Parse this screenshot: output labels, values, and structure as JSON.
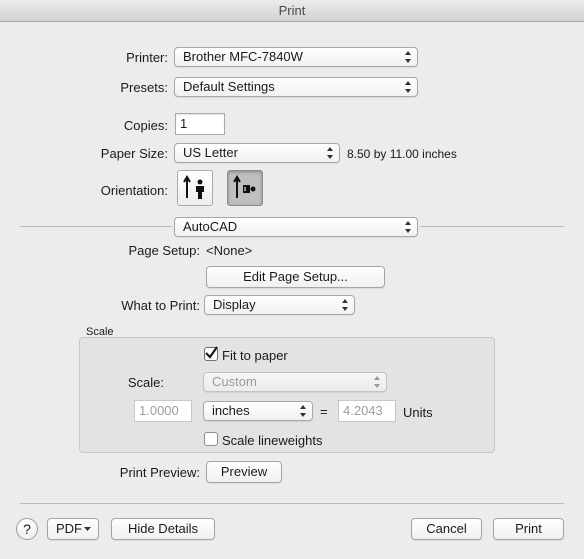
{
  "window": {
    "title": "Print"
  },
  "printer": {
    "label": "Printer:",
    "value": "Brother MFC-7840W"
  },
  "presets": {
    "label": "Presets:",
    "value": "Default Settings"
  },
  "copies": {
    "label": "Copies:",
    "value": "1"
  },
  "paper_size": {
    "label": "Paper Size:",
    "value": "US Letter",
    "dimensions": "8.50 by 11.00 inches"
  },
  "orientation": {
    "label": "Orientation:",
    "options": [
      "portrait",
      "landscape"
    ],
    "selected": "landscape"
  },
  "section_popup": {
    "value": "AutoCAD"
  },
  "page_setup": {
    "label": "Page Setup:",
    "value": "<None>",
    "edit_button": "Edit Page Setup..."
  },
  "what_to_print": {
    "label": "What to Print:",
    "value": "Display"
  },
  "scale_group": {
    "title": "Scale",
    "fit_to_paper": {
      "label": "Fit to paper",
      "checked": true
    },
    "scale_label": "Scale:",
    "scale_value": "Custom",
    "left_value": "1.0000",
    "units_popup": "inches",
    "equals": "=",
    "right_value": "4.2043",
    "units_label": "Units",
    "lineweights": {
      "label": "Scale lineweights",
      "checked": false
    }
  },
  "print_preview": {
    "label": "Print Preview:",
    "button": "Preview"
  },
  "footer": {
    "help": "?",
    "pdf": "PDF",
    "hide_details": "Hide Details",
    "cancel": "Cancel",
    "print": "Print"
  }
}
